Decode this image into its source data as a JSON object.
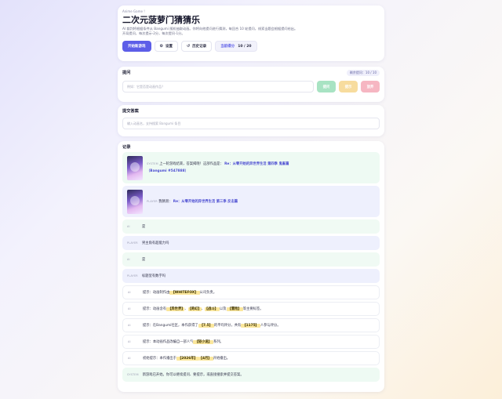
{
  "hero": {
    "tag": "Anime Game !",
    "title": "二次元菠萝门猜猜乐",
    "description_line1": "AI 裁判将根据条件从 Bangumi 随机抽取动画。你将向他提问进行猜测，每回合 10 轮提问，线索当题会根据提问给出。",
    "description_line2": "开局提问，每次提示-2分，每次提问-1分。",
    "start_label": "开始新游戏",
    "settings_label": "设置",
    "history_label": "历史记录",
    "score_label": "当前得分",
    "score_value": "10 / 20"
  },
  "ask": {
    "title": "提问",
    "counter": "剩余提问：10 / 10",
    "placeholder": "例如：它是否是动画作品？",
    "btn_ask": "提问",
    "btn_hint": "提示",
    "btn_giveup": "放弃"
  },
  "submit": {
    "title": "提交答案",
    "placeholder": "输入动画名，支持搜索 Bangumi 条目"
  },
  "log": {
    "title": "记录",
    "entries": [
      {
        "role": "SYSTEM",
        "text": "上一轮游戏结束，答案揭晓！这部作品是：",
        "answer": "Re：从零开始的异世界生活 第四季 鬼畜篇",
        "answer2": "（Bangumi #547888）"
      },
      {
        "role": "PLAYER",
        "text": "我猜测：",
        "answer": "Re：从零开始的异世界生活 第三季 反击篇"
      },
      {
        "role": "AI",
        "text": "是"
      },
      {
        "role": "PLAYER",
        "text": "男主角有超能力吗"
      },
      {
        "role": "AI",
        "text": "是"
      },
      {
        "role": "PLAYER",
        "text": "标题里有数字吗"
      },
      {
        "role": "AI",
        "pre": "提示：动画制作由",
        "hl1": "【WHITEFOX】",
        "post": "公司负责。"
      },
      {
        "role": "AI",
        "pre": "提示：动画含有",
        "hl1": "【异世界】",
        "mid1": "、",
        "hl2": "【奇幻】",
        "mid2": "、",
        "hl3": "【战斗】",
        "mid3": "以及",
        "hl4": "【冒险】",
        "post": "等主要标签。"
      },
      {
        "role": "AI",
        "pre": "提示：在Bangumi社区，本作获得了",
        "hl1": "【7.5】",
        "mid1": "的平均评分，共有",
        "hl2": "【1175】",
        "post": "人参与评分。"
      },
      {
        "role": "AI",
        "pre": "提示：本动画作品改编自一部人气",
        "hl1": "【轻小说】",
        "post": "系列。"
      },
      {
        "role": "AI",
        "pre": "初始提示：本作播出于",
        "hl1": "【2026年】",
        "mid1": "",
        "hl2": "【4月】",
        "post": "开始播出。"
      },
      {
        "role": "SYSTEM",
        "text": "新游戏已开始。你可以继续提问、要提示，或直接搜索并提交答案。"
      }
    ]
  }
}
